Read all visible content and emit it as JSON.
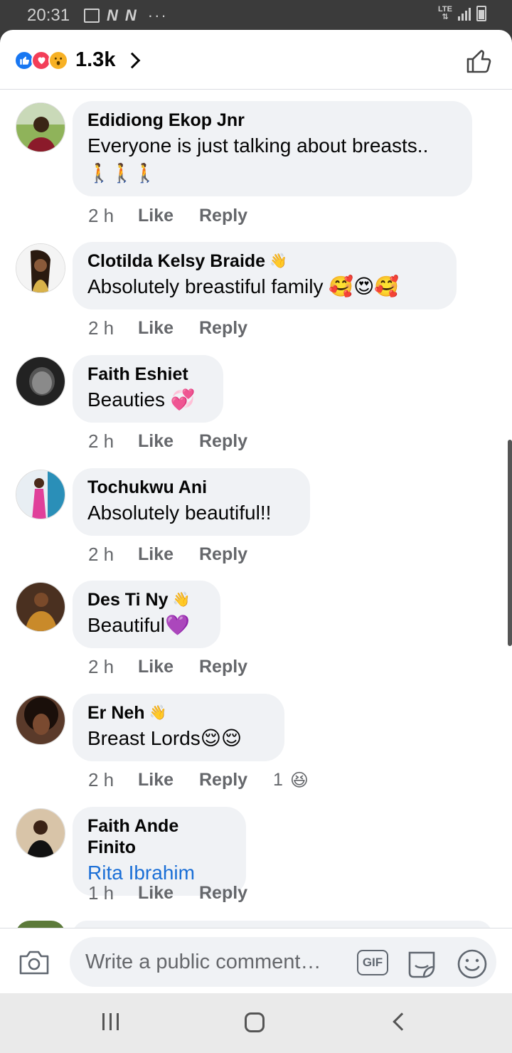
{
  "status_bar": {
    "time": "20:31",
    "network": "LTE",
    "notif_letters": [
      "N",
      "N"
    ],
    "more": "···"
  },
  "header": {
    "reaction_icons": [
      "like-icon",
      "love-icon",
      "wow-icon"
    ],
    "reaction_count": "1.3k"
  },
  "comments": [
    {
      "name": "Edidiong Ekop Jnr",
      "text": "Everyone is just talking about breasts..",
      "text2": "🚶🚶🚶",
      "wave": "",
      "time": "2 h",
      "like": "Like",
      "reply": "Reply",
      "avatar_color": "#6b8f3b"
    },
    {
      "name": "Clotilda Kelsy Braide",
      "text": "Absolutely breastiful family 🥰😍🥰",
      "wave": "👋",
      "time": "2 h",
      "like": "Like",
      "reply": "Reply",
      "avatar_color": "#c89b4a"
    },
    {
      "name": "Faith Eshiet",
      "text": "Beauties 💞",
      "wave": "",
      "time": "2 h",
      "like": "Like",
      "reply": "Reply",
      "avatar_color": "#2a2a2a"
    },
    {
      "name": "Tochukwu Ani",
      "text": "Absolutely beautiful!!",
      "wave": "",
      "time": "2 h",
      "like": "Like",
      "reply": "Reply",
      "avatar_color": "#e05a9e"
    },
    {
      "name": "Des Ti Ny",
      "text": "Beautiful💜",
      "wave": "👋",
      "time": "2 h",
      "like": "Like",
      "reply": "Reply",
      "avatar_color": "#b8732e"
    },
    {
      "name": "Er Neh",
      "text": "Breast Lords😌😌",
      "wave": "👋",
      "time": "2 h",
      "like": "Like",
      "reply": "Reply",
      "reaction_count": "1",
      "reaction_emoji": "😆",
      "avatar_color": "#3b2418"
    },
    {
      "name": "Faith Ande Finito",
      "text": "Rita Ibrahim",
      "mention": true,
      "wave": "",
      "time": "1 h",
      "like": "Like",
      "reply": "Reply",
      "avatar_color": "#7a5a3a"
    }
  ],
  "composer": {
    "placeholder": "Write a public comment…",
    "gif_label": "GIF"
  },
  "colors": {
    "brand_blue": "#1877f2",
    "mention_blue": "#1b6fd6",
    "bubble": "#f0f2f5",
    "secondary_text": "#65676b"
  }
}
